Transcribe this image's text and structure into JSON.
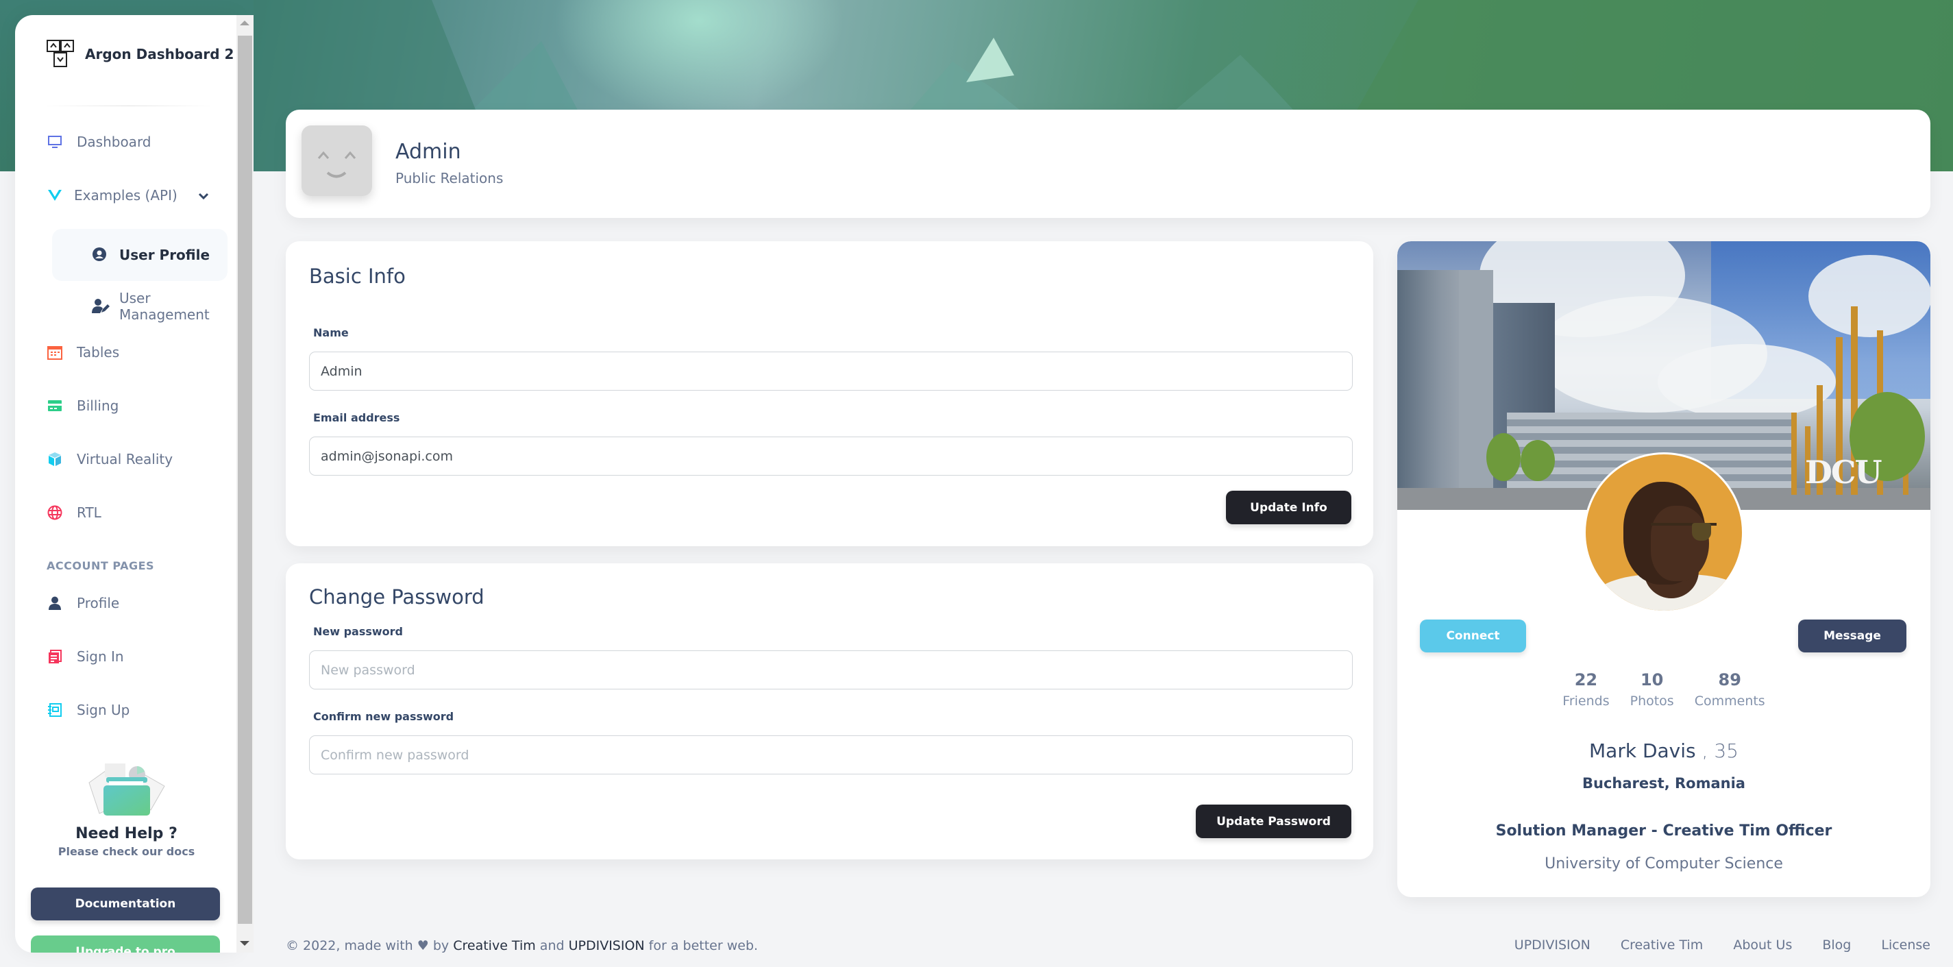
{
  "brand": {
    "name": "Argon Dashboard 2",
    "logo_icon": "argon-logo-icon"
  },
  "sidebar": {
    "items": [
      {
        "label": "Dashboard",
        "icon": "monitor-icon",
        "color": "#5e72e4"
      },
      {
        "label": "Examples (API)",
        "icon": "vue-icon",
        "color": "#11cdef",
        "expanded": true
      },
      {
        "label": "User Profile",
        "icon": "user-circle-icon",
        "active": true,
        "sub": true
      },
      {
        "label": "User Management",
        "icon": "user-edit-icon",
        "sub": true
      },
      {
        "label": "Tables",
        "icon": "calendar-grid-icon",
        "color": "#fb6340"
      },
      {
        "label": "Billing",
        "icon": "credit-card-icon",
        "color": "#2dce89"
      },
      {
        "label": "Virtual Reality",
        "icon": "cube-icon",
        "color": "#11cdef"
      },
      {
        "label": "RTL",
        "icon": "globe-icon",
        "color": "#f5365c"
      }
    ],
    "section_heading": "ACCOUNT PAGES",
    "account_items": [
      {
        "label": "Profile",
        "icon": "user-icon",
        "color": "#344767"
      },
      {
        "label": "Sign In",
        "icon": "document-icon",
        "color": "#f5365c"
      },
      {
        "label": "Sign Up",
        "icon": "notebook-icon",
        "color": "#11cdef"
      }
    ],
    "help": {
      "title": "Need Help ?",
      "subtitle": "Please check our docs"
    },
    "documentation_button": "Documentation",
    "upgrade_button": "Upgrade to pro"
  },
  "header": {
    "name": "Admin",
    "role": "Public Relations"
  },
  "basic_info": {
    "title": "Basic Info",
    "name_label": "Name",
    "name_value": "Admin",
    "email_label": "Email address",
    "email_value": "admin@jsonapi.com",
    "submit": "Update Info"
  },
  "change_password": {
    "title": "Change Password",
    "new_label": "New password",
    "new_placeholder": "New password",
    "confirm_label": "Confirm new password",
    "confirm_placeholder": "Confirm new password",
    "submit": "Update Password"
  },
  "profile": {
    "cover_text": "DCU",
    "connect": "Connect",
    "message": "Message",
    "stats": [
      {
        "value": "22",
        "label": "Friends"
      },
      {
        "value": "10",
        "label": "Photos"
      },
      {
        "value": "89",
        "label": "Comments"
      }
    ],
    "name": "Mark Davis",
    "age": ", 35",
    "location": "Bucharest, Romania",
    "job": "Solution Manager - Creative Tim Officer",
    "education": "University of Computer Science"
  },
  "footer": {
    "copyright_prefix": "© 2022, made with",
    "by": "by",
    "author1": "Creative Tim",
    "and": "and",
    "author2": "UPDIVISION",
    "suffix": "for a better web.",
    "links": [
      "UPDIVISION",
      "Creative Tim",
      "About Us",
      "Blog",
      "License"
    ]
  }
}
